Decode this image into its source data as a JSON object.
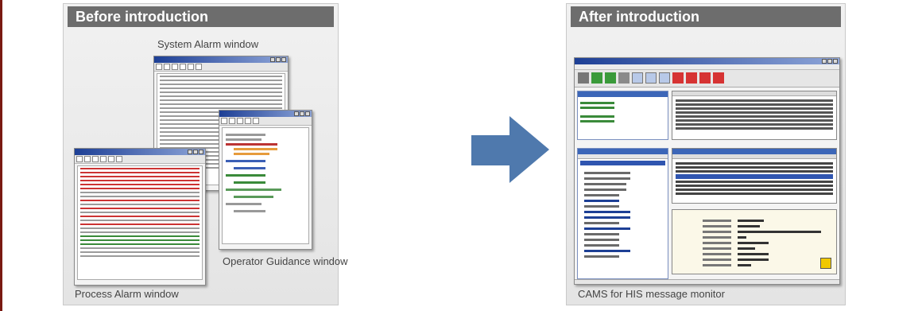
{
  "left_panel": {
    "header": "Before introduction",
    "system_alarm_label": "System Alarm window",
    "operator_guidance_label": "Operator Guidance window",
    "process_alarm_label": "Process Alarm window"
  },
  "right_panel": {
    "header": "After introduction",
    "caption": "CAMS for HIS message monitor"
  },
  "colors": {
    "header_bg": "#6d6d6d",
    "arrow": "#4f79ad",
    "left_rule": "#7a1a12",
    "titlebar": "#1d3f95"
  },
  "icons": {
    "arrow": "right-arrow-icon"
  }
}
